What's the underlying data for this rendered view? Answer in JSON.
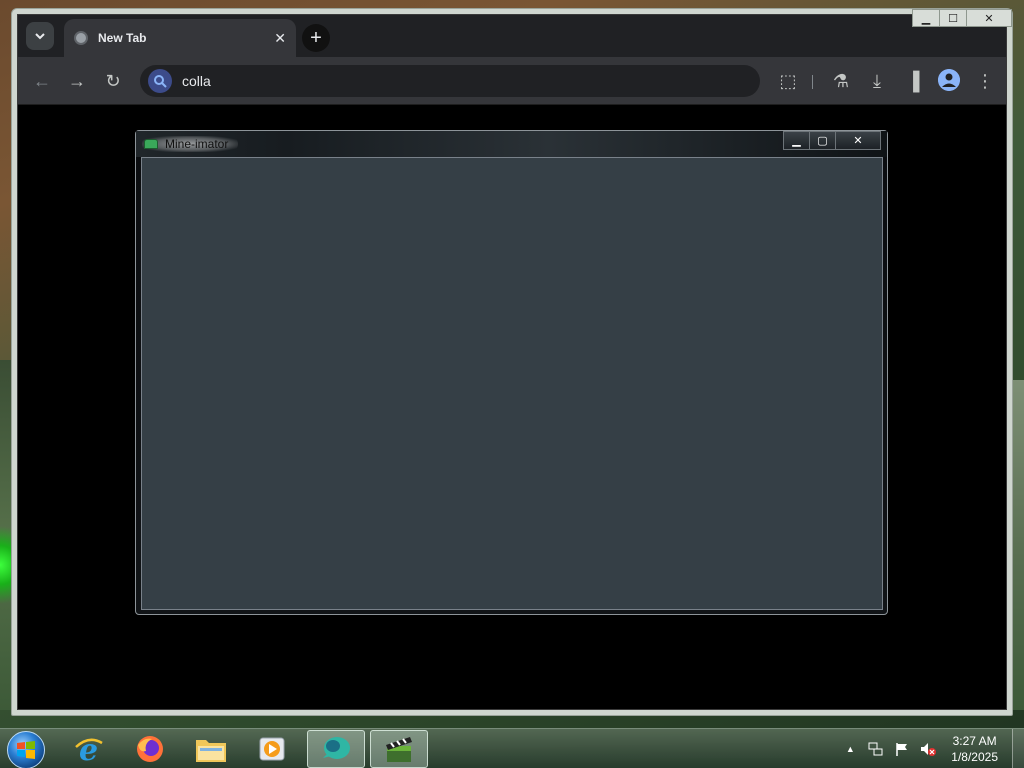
{
  "browser": {
    "tab_title": "New Tab",
    "tab_close": "✕",
    "new_tab": "+",
    "omnibox_text": "colla",
    "window_controls": {
      "minimize": "▁",
      "maximize": "☐",
      "close": "✕"
    },
    "toolbar_icons": {
      "back": "←",
      "forward": "→",
      "reload": "↻",
      "extensions": "⬚",
      "labs": "⚗",
      "downloads": "⤓",
      "side_panel": "▐",
      "menu": "⋮"
    }
  },
  "app_window": {
    "title": "Mine-imator",
    "controls": {
      "minimize": "▁",
      "maximize": "▢",
      "close": "✕"
    },
    "client_color": "#353f46"
  },
  "taskbar": {
    "pinned": [
      {
        "name": "internet-explorer",
        "glyph": "e"
      },
      {
        "name": "firefox",
        "glyph": ""
      },
      {
        "name": "file-explorer",
        "glyph": ""
      },
      {
        "name": "media-player",
        "glyph": "▶"
      },
      {
        "name": "mine-imator-task",
        "glyph": ""
      },
      {
        "name": "minecraft-task",
        "glyph": ""
      }
    ],
    "tray": {
      "expand": "▲",
      "time": "3:27 AM",
      "date": "1/8/2025"
    }
  }
}
